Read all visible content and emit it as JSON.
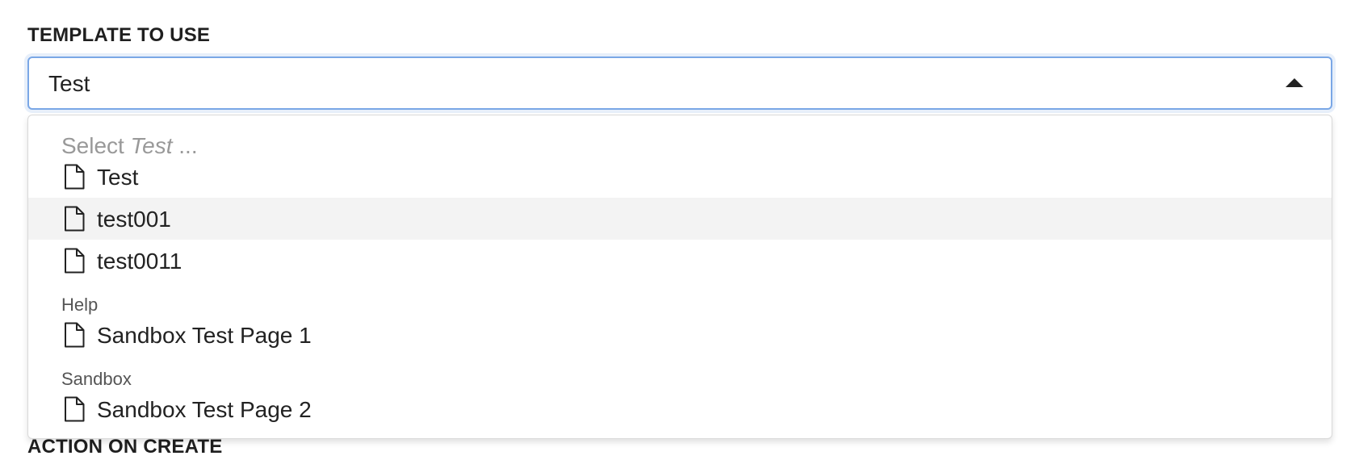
{
  "form": {
    "template_label": "TEMPLATE TO USE",
    "action_label": "ACTION ON CREATE"
  },
  "select": {
    "value": "Test",
    "expanded": true,
    "caret_icon": "caret-up-icon"
  },
  "dropdown": {
    "placeholder_prefix": "Select ",
    "placeholder_emph": "Test",
    "placeholder_suffix": " ...",
    "options": [
      {
        "label": "Test",
        "icon": "document-icon",
        "highlighted": false
      },
      {
        "label": "test001",
        "icon": "document-icon",
        "highlighted": true
      },
      {
        "label": "test0011",
        "icon": "document-icon",
        "highlighted": false
      }
    ],
    "groups": [
      {
        "name": "Help",
        "options": [
          {
            "label": "Sandbox Test Page 1",
            "icon": "document-icon"
          }
        ]
      },
      {
        "name": "Sandbox",
        "options": [
          {
            "label": "Sandbox Test Page 2",
            "icon": "document-icon"
          }
        ]
      }
    ]
  },
  "colors": {
    "focus_border": "#7aa7e6",
    "highlight_bg": "#f3f3f3",
    "placeholder": "#999999"
  }
}
